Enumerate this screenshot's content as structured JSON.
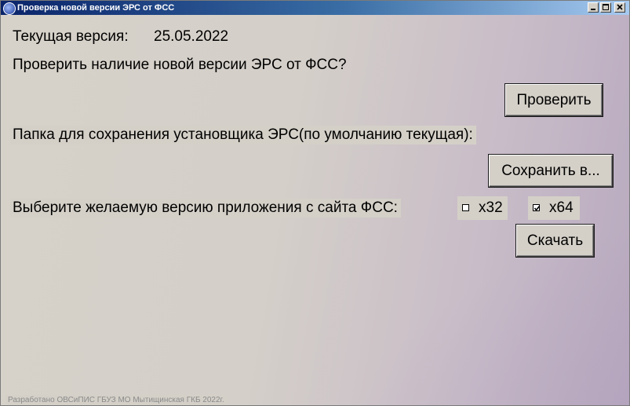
{
  "window": {
    "title": "Проверка новой версии ЭРС от ФСС",
    "min_label": "",
    "max_label": "",
    "close_label": ""
  },
  "current_version": {
    "label": "Текущая версия:",
    "value": "25.05.2022"
  },
  "check": {
    "prompt": "Проверить наличие новой версии ЭРС от ФСС?",
    "button": "Проверить"
  },
  "save": {
    "prompt": "Папка для сохранения установщика ЭРС(по умолчанию текущая):",
    "button": "Сохранить в..."
  },
  "download": {
    "prompt": "Выберите желаемую версию приложения с сайта ФСС:",
    "options": [
      {
        "label": "x32",
        "checked": false
      },
      {
        "label": "x64",
        "checked": true
      }
    ],
    "button": "Скачать"
  },
  "footer": "Разработано ОВСиПИС ГБУЗ МО Мытищинская ГКБ 2022г."
}
